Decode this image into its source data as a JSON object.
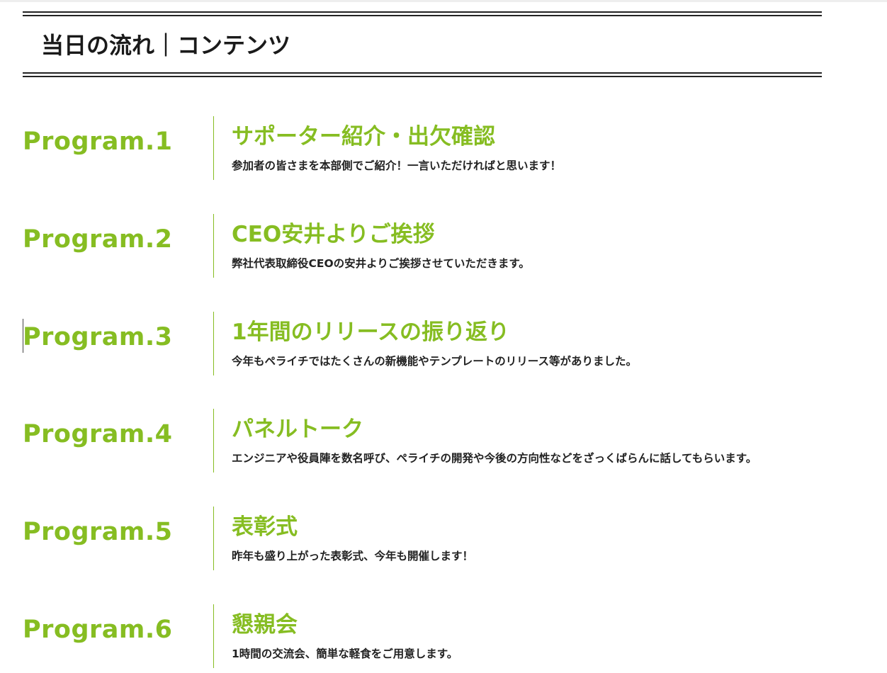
{
  "section": {
    "title": "当日の流れ｜コンテンツ"
  },
  "programs": [
    {
      "number": "Program.1",
      "title": "サポーター紹介・出欠確認",
      "description": "参加者の皆さまを本部側でご紹介！一言いただければと思います！"
    },
    {
      "number": "Program.2",
      "title": "CEO安井よりご挨拶",
      "description": "弊社代表取締役CEOの安井よりご挨拶させていただきます。"
    },
    {
      "number": "Program.3",
      "title": "1年間のリリースの振り返り",
      "description": "今年もペライチではたくさんの新機能やテンプレートのリリース等がありました。"
    },
    {
      "number": "Program.4",
      "title": "パネルトーク",
      "description": "エンジニアや役員陣を数名呼び、ペライチの開発や今後の方向性などをざっくばらんに話してもらいます。"
    },
    {
      "number": "Program.5",
      "title": "表彰式",
      "description": "昨年も盛り上がった表彰式、今年も開催します！"
    },
    {
      "number": "Program.6",
      "title": "懇親会",
      "description": "1時間の交流会、簡単な軽食をご用意します。"
    }
  ],
  "colors": {
    "accent": "#86bd22",
    "text": "#222222",
    "rule": "#222222"
  }
}
